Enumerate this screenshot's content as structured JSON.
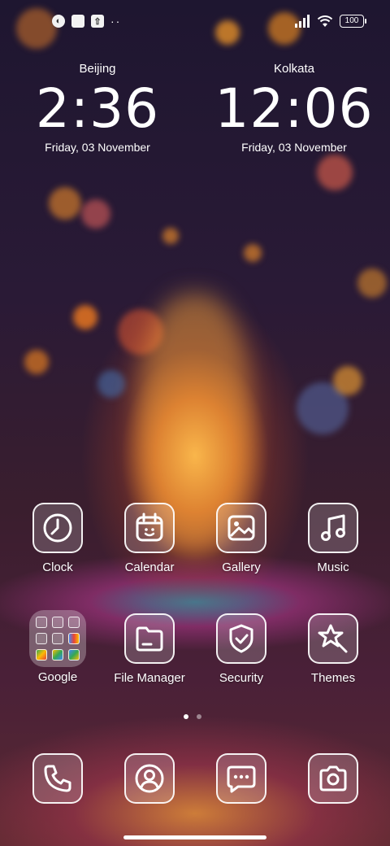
{
  "status_bar": {
    "battery": "100",
    "left_icons": [
      "notification-icon-1",
      "notification-icon-2",
      "upload-icon"
    ],
    "more": "··"
  },
  "clocks": [
    {
      "city": "Beijing",
      "time": "2:36",
      "date": "Friday, 03 November"
    },
    {
      "city": "Kolkata",
      "time": "12:06",
      "date": "Friday, 03 November"
    }
  ],
  "apps_row1": [
    {
      "label": "Clock",
      "icon": "clock-icon"
    },
    {
      "label": "Calendar",
      "icon": "calendar-icon"
    },
    {
      "label": "Gallery",
      "icon": "gallery-icon"
    },
    {
      "label": "Music",
      "icon": "music-icon"
    }
  ],
  "apps_row2": [
    {
      "label": "Google",
      "icon": "google-folder-icon"
    },
    {
      "label": "File Manager",
      "icon": "folder-icon"
    },
    {
      "label": "Security",
      "icon": "shield-icon"
    },
    {
      "label": "Themes",
      "icon": "themes-icon"
    }
  ],
  "dock": [
    {
      "icon": "phone-icon"
    },
    {
      "icon": "contacts-icon"
    },
    {
      "icon": "messages-icon"
    },
    {
      "icon": "camera-icon"
    }
  ],
  "pages": {
    "count": 2,
    "current": 1
  }
}
